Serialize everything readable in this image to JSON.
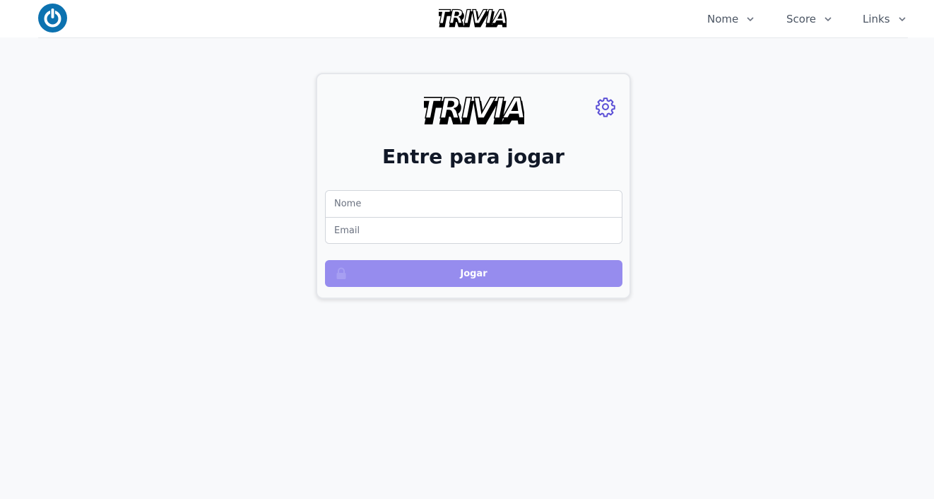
{
  "nav": {
    "logo_text": "TRIVIA",
    "menus": [
      {
        "label": "Nome"
      },
      {
        "label": "Score"
      },
      {
        "label": "Links"
      }
    ]
  },
  "card": {
    "logo_text": "TRIVIA",
    "title": "Entre para jogar",
    "name_placeholder": "Nome",
    "email_placeholder": "Email",
    "play_label": "Jogar"
  },
  "colors": {
    "brand_blue": "#0c72b0",
    "accent": "#968cee",
    "gear": "#5b4fd6"
  },
  "icons": [
    "power-icon",
    "chevron-down-icon",
    "gear-icon",
    "lock-icon"
  ]
}
